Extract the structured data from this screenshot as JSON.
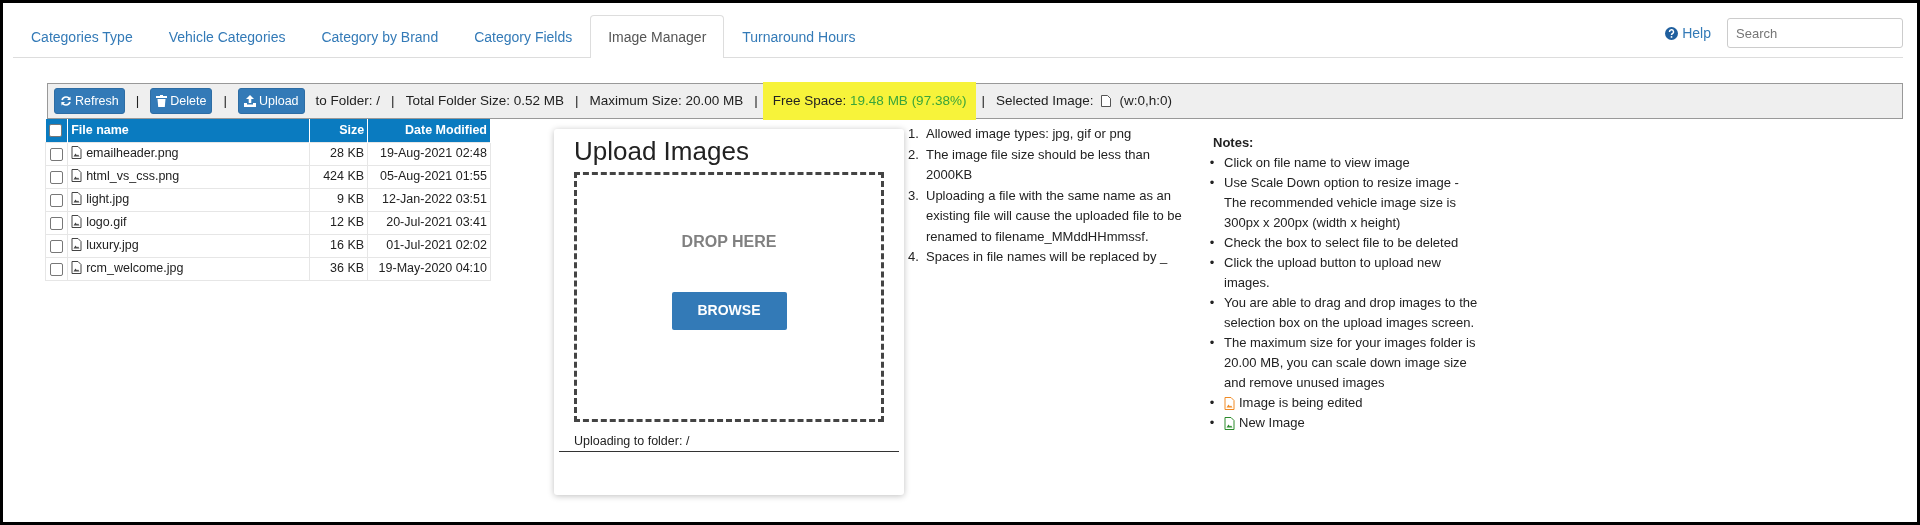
{
  "tabs": [
    {
      "label": "Categories Type",
      "selected": false
    },
    {
      "label": "Vehicle Categories",
      "selected": false
    },
    {
      "label": "Category by Brand",
      "selected": false
    },
    {
      "label": "Category Fields",
      "selected": false
    },
    {
      "label": "Image Manager",
      "selected": true
    },
    {
      "label": "Turnaround Hours",
      "selected": false
    }
  ],
  "help": {
    "label": "Help"
  },
  "search": {
    "placeholder": "Search"
  },
  "toolbar": [
    {
      "kind": "button",
      "label": "Refresh"
    },
    {
      "kind": "separator",
      "text": "|"
    },
    {
      "kind": "button",
      "label": "Delete"
    },
    {
      "kind": "separator",
      "text": "|"
    },
    {
      "kind": "button",
      "label": "Upload"
    },
    {
      "kind": "text",
      "text": "to Folder: /"
    },
    {
      "kind": "separator",
      "text": "|"
    },
    {
      "kind": "text",
      "text": "Total Folder Size: 0.52 MB"
    },
    {
      "kind": "separator",
      "text": "|"
    },
    {
      "kind": "text",
      "text": "Maximum Size: 20.00 MB"
    },
    {
      "kind": "separator",
      "text": "|"
    },
    {
      "kind": "highlight",
      "text": "Free Space:",
      "value": "19.48 MB (97.38%)"
    },
    {
      "kind": "separator",
      "text": "|"
    },
    {
      "kind": "selected",
      "text": "Selected Image:",
      "value": "(w:0,h:0)"
    }
  ],
  "file_table": {
    "select_all": {
      "checked": false
    },
    "columns": [
      "File name",
      "Size",
      "Date Modified"
    ],
    "rows": [
      {
        "checked": false,
        "name": "emailheader.png",
        "size": "28 KB",
        "date": "19-Aug-2021 02:48"
      },
      {
        "checked": false,
        "name": "html_vs_css.png",
        "size": "424 KB",
        "date": "05-Aug-2021 01:55"
      },
      {
        "checked": false,
        "name": "light.jpg",
        "size": "9 KB",
        "date": "12-Jan-2022 03:51"
      },
      {
        "checked": false,
        "name": "logo.gif",
        "size": "12 KB",
        "date": "20-Jul-2021 03:41"
      },
      {
        "checked": false,
        "name": "luxury.jpg",
        "size": "16 KB",
        "date": "01-Jul-2021 02:02"
      },
      {
        "checked": false,
        "name": "rcm_welcome.jpg",
        "size": "36 KB",
        "date": "19-May-2020 04:10"
      }
    ]
  },
  "upload": {
    "title": "Upload Images",
    "drop_text": "DROP HERE",
    "browse": "BROWSE",
    "folder": "Uploading to folder: /"
  },
  "rules": [
    {
      "number": "1.",
      "text": "Allowed image types: jpg, gif or png"
    },
    {
      "number": "2.",
      "text": "The image file size should be less than 2000KB"
    },
    {
      "number": "3.",
      "text": "Uploading a file with the same name as an existing file will cause the uploaded file to be renamed to filename_MMddHHmmssf."
    },
    {
      "number": "4.",
      "text": "Spaces in file names will be replaced by _"
    }
  ],
  "notes": {
    "title": "Notes:",
    "items": [
      {
        "kind": "text",
        "bullet": "•",
        "text": "Click on file name to view image"
      },
      {
        "kind": "text",
        "bullet": "•",
        "text": "Use Scale Down option to resize image - The recommended vehicle image size is 300px x 200px (width x height)"
      },
      {
        "kind": "text",
        "bullet": "•",
        "text": "Check the box to select file to be deleted"
      },
      {
        "kind": "text",
        "bullet": "•",
        "text": "Click the upload button to upload new images."
      },
      {
        "kind": "text",
        "bullet": "•",
        "text": "You are able to drag and drop images to the selection box on the upload images screen."
      },
      {
        "kind": "text",
        "bullet": "•",
        "text": "The maximum size for your images folder is 20.00 MB, you can scale down image size and remove unused images"
      },
      {
        "kind": "edited",
        "bullet": "•",
        "text": "Image is being edited"
      },
      {
        "kind": "new",
        "bullet": "•",
        "text": "New Image"
      }
    ]
  }
}
